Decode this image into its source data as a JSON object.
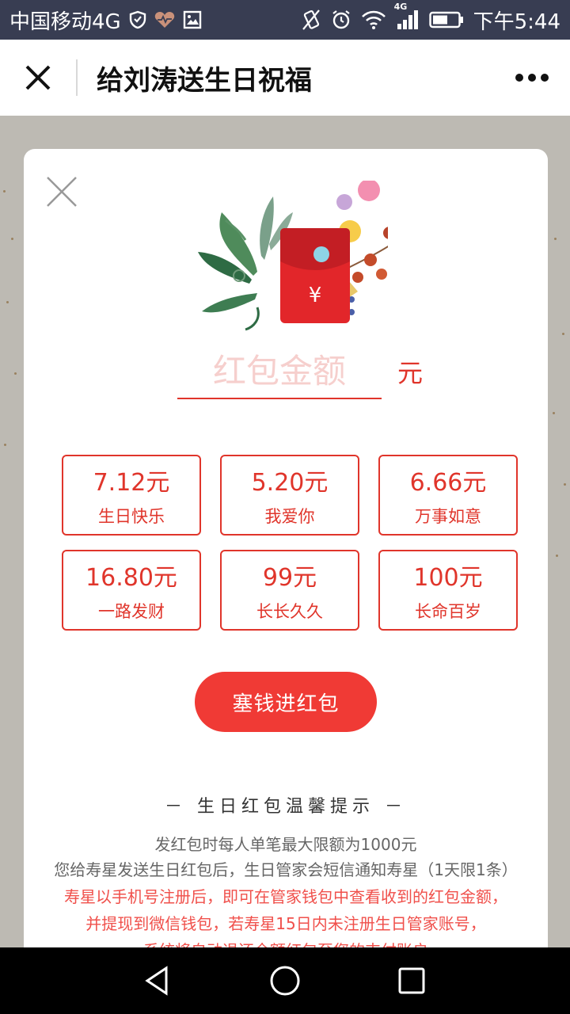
{
  "status_bar": {
    "carrier": "中国移动4G",
    "network": "4G",
    "time": "下午5:44"
  },
  "title_bar": {
    "title": "给刘涛送生日祝福"
  },
  "card": {
    "amount": {
      "placeholder": "红包金额",
      "value": "",
      "unit": "元"
    },
    "options": [
      {
        "amount": "7.12元",
        "wish": "生日快乐"
      },
      {
        "amount": "5.20元",
        "wish": "我爱你"
      },
      {
        "amount": "6.66元",
        "wish": "万事如意"
      },
      {
        "amount": "16.80元",
        "wish": "一路发财"
      },
      {
        "amount": "99元",
        "wish": "长长久久"
      },
      {
        "amount": "100元",
        "wish": "长命百岁"
      }
    ],
    "submit_label": "塞钱进红包",
    "tips": {
      "title": "－ 生日红包温馨提示 －",
      "lines": [
        "发红包时每人单笔最大限额为1000元",
        "您给寿星发送生日红包后，生日管家会短信通知寿星（1天限1条）",
        "寿星以手机号注册后，即可在管家钱包中查看收到的红包金额，",
        "并提现到微信钱包，若寿星15日内未注册生日管家账号，",
        "系统将自动退还全额红包至您的支付账户"
      ]
    },
    "envelope_symbol": "¥"
  },
  "colors": {
    "accent": "#e0352b",
    "button": "#f03a35",
    "status_bar": "#383d52",
    "backdrop": "#bdbab3"
  }
}
